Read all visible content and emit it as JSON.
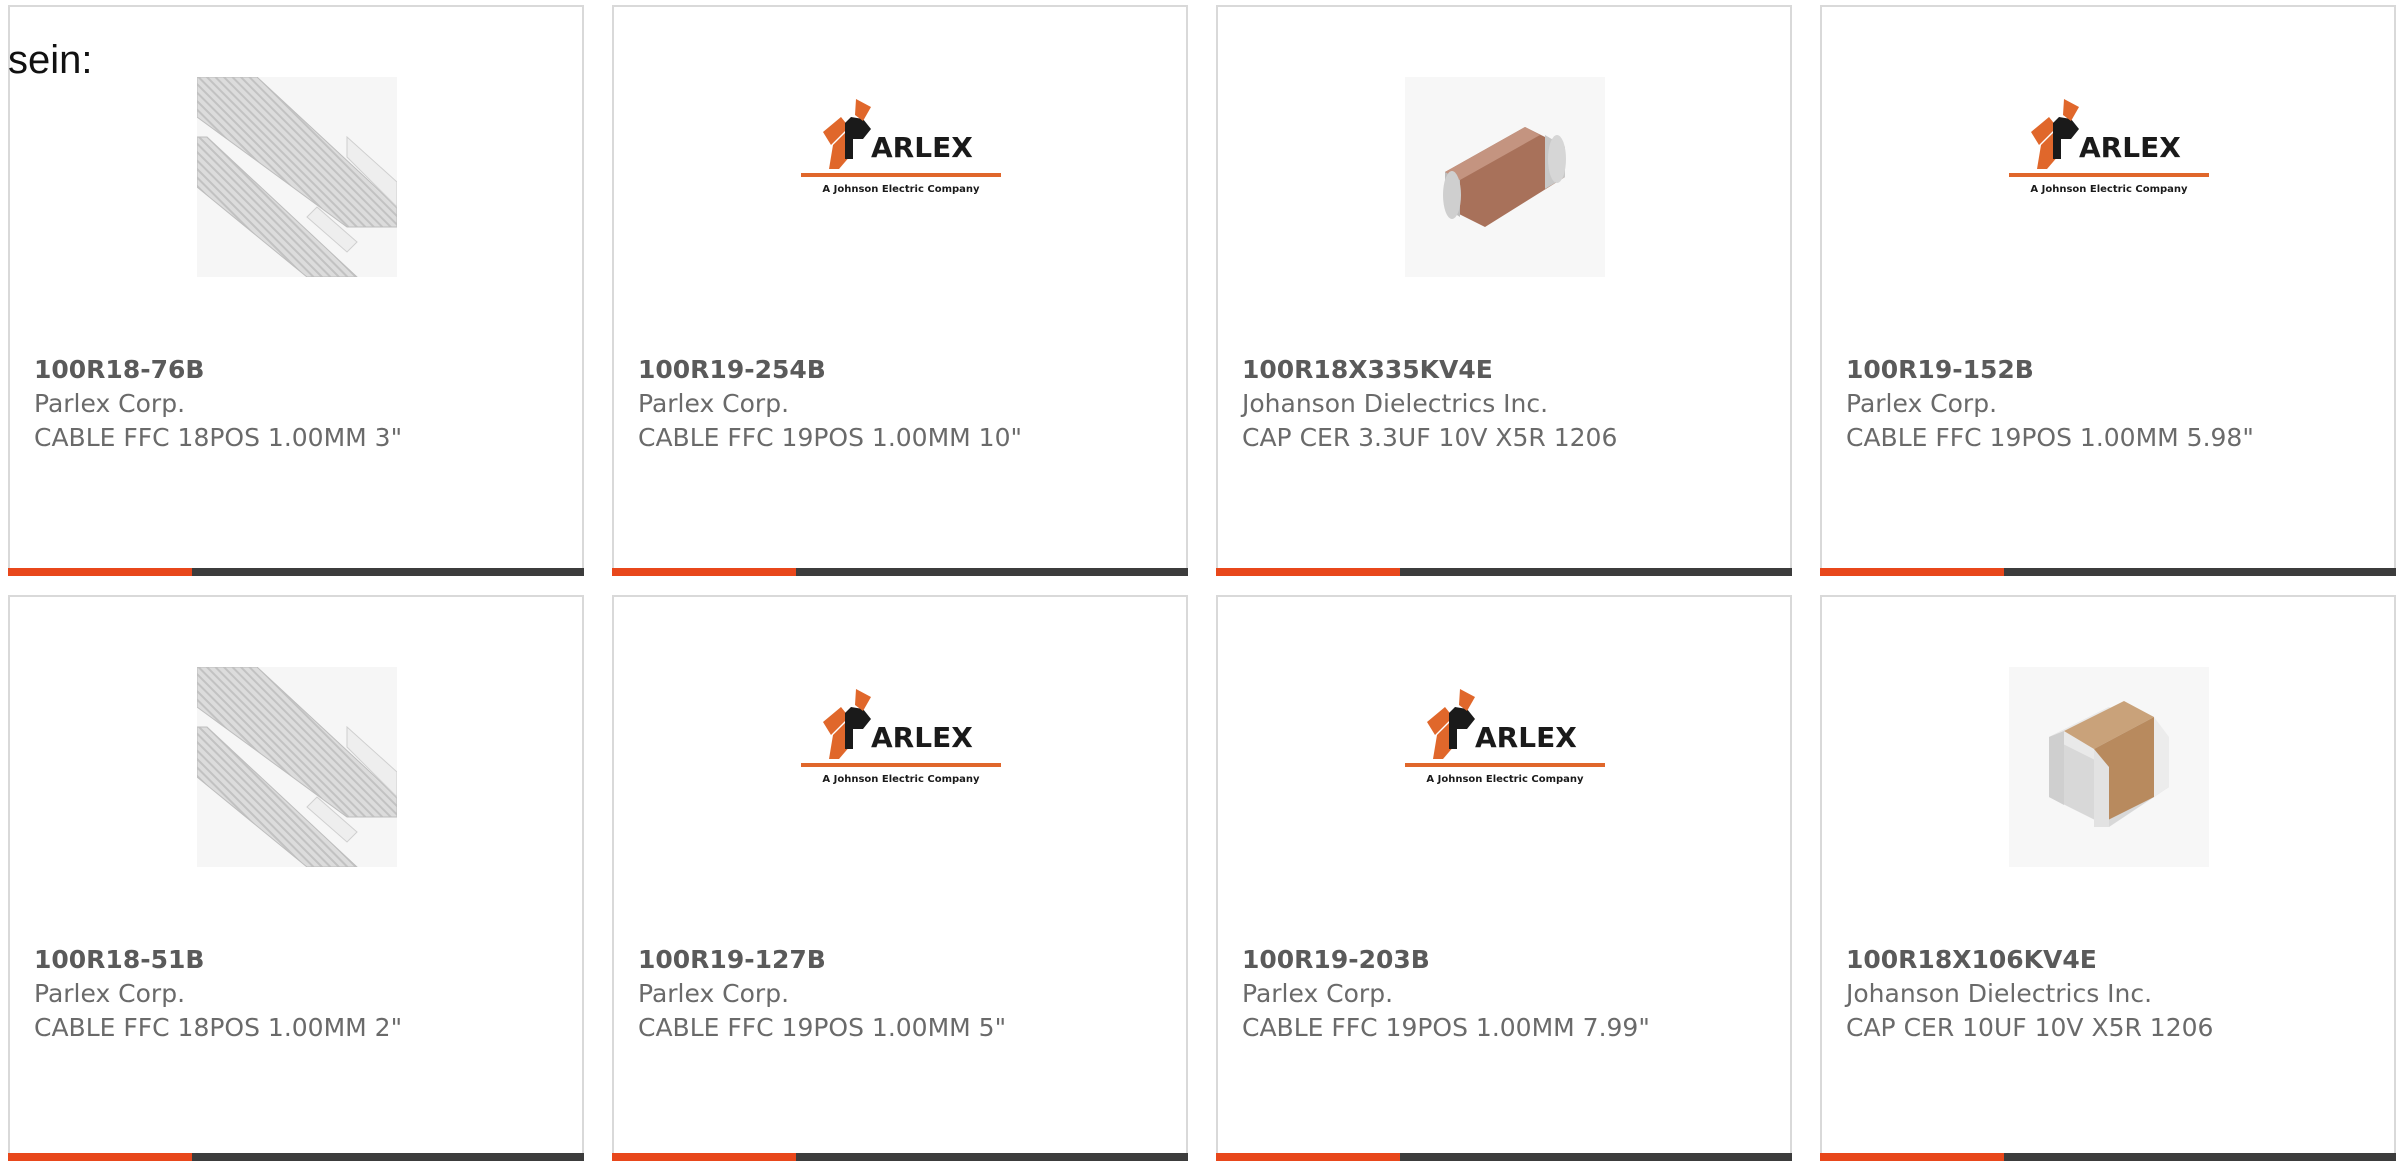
{
  "intro_text": "sein:",
  "colors": {
    "accent": "#e8471b",
    "bar": "#3c3c3c",
    "border": "#d9d9d9",
    "text_part": "#5a5a5a",
    "text_body": "#6a6a6a",
    "logo_orange": "#e0672b"
  },
  "products": [
    {
      "part_number": "100R18-76B",
      "manufacturer": "Parlex Corp.",
      "description": "CABLE FFC 18POS 1.00MM 3\"",
      "image": "ffc-cable-image"
    },
    {
      "part_number": "100R19-254B",
      "manufacturer": "Parlex Corp.",
      "description": "CABLE FFC 19POS 1.00MM 10\"",
      "image": "parlex-logo",
      "logo_text": "ARLEX",
      "logo_tagline": "A Johnson Electric Company"
    },
    {
      "part_number": "100R18X335KV4E",
      "manufacturer": "Johanson Dielectrics Inc.",
      "description": "CAP CER 3.3UF 10V X5R 1206",
      "image": "ceramic-capacitor-image"
    },
    {
      "part_number": "100R19-152B",
      "manufacturer": "Parlex Corp.",
      "description": "CABLE FFC 19POS 1.00MM 5.98\"",
      "image": "parlex-logo",
      "logo_text": "ARLEX",
      "logo_tagline": "A Johnson Electric Company"
    },
    {
      "part_number": "100R18-51B",
      "manufacturer": "Parlex Corp.",
      "description": "CABLE FFC 18POS 1.00MM 2\"",
      "image": "ffc-cable-image"
    },
    {
      "part_number": "100R19-127B",
      "manufacturer": "Parlex Corp.",
      "description": "CABLE FFC 19POS 1.00MM 5\"",
      "image": "parlex-logo",
      "logo_text": "ARLEX",
      "logo_tagline": "A Johnson Electric Company"
    },
    {
      "part_number": "100R19-203B",
      "manufacturer": "Parlex Corp.",
      "description": "CABLE FFC 19POS 1.00MM 7.99\"",
      "image": "parlex-logo",
      "logo_text": "ARLEX",
      "logo_tagline": "A Johnson Electric Company"
    },
    {
      "part_number": "100R18X106KV4E",
      "manufacturer": "Johanson Dielectrics Inc.",
      "description": "CAP CER 10UF 10V X5R 1206",
      "image": "chip-capacitor-image"
    }
  ]
}
